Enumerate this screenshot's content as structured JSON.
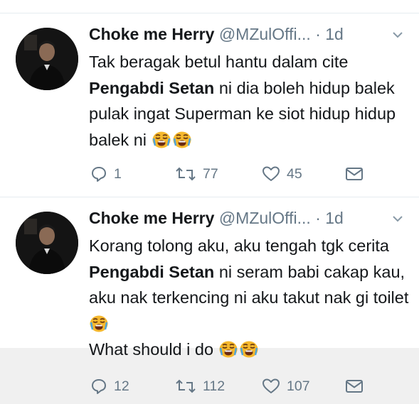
{
  "tweets": [
    {
      "name": "Choke me Herry",
      "handle": "@MZulOffi...",
      "time": "· 1d",
      "text_parts": [
        "Tak beragak betul hantu dalam cite ",
        "Pengabdi Setan",
        " ni dia boleh hidup balek pulak ingat Superman ke siot hidup hidup balek ni"
      ],
      "emoji": [
        "crying-face",
        "crying-face"
      ],
      "replies": "1",
      "retweets": "77",
      "likes": "45"
    },
    {
      "name": "Choke me Herry",
      "handle": "@MZulOffi...",
      "time": "· 1d",
      "text_parts": [
        "Korang tolong aku, aku tengah tgk cerita ",
        "Pengabdi Setan",
        " ni seram babi cakap kau, aku nak terkencing ni aku takut nak gi toilet",
        "What should i do"
      ],
      "emoji": [
        "crying-face",
        "crying-face",
        "crying-face"
      ],
      "replies": "12",
      "retweets": "112",
      "likes": "107"
    }
  ],
  "colors": {
    "text": "#14171a",
    "muted": "#657786",
    "divider": "#e6ecf0",
    "emoji": "#f5b82e"
  },
  "icons": [
    "caret-down-icon",
    "reply-icon",
    "retweet-icon",
    "like-icon",
    "direct-message-icon"
  ]
}
